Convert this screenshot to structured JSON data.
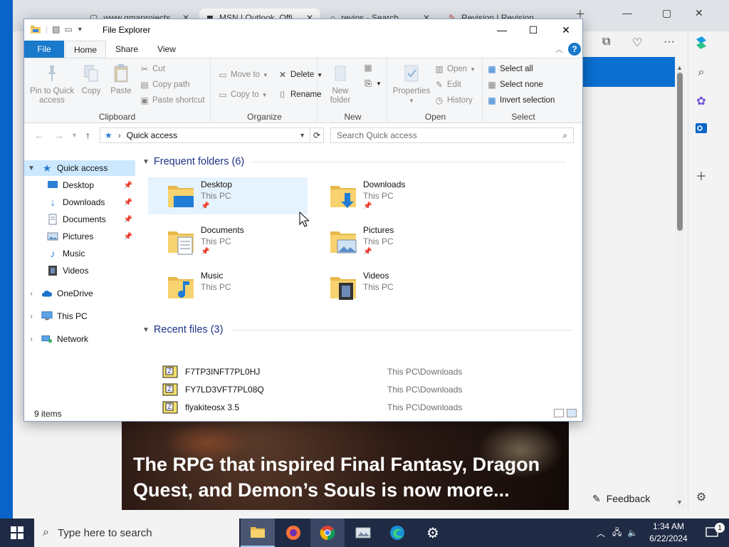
{
  "browser": {
    "tabs": [
      {
        "label": "www.gmaprojects",
        "close": "✕"
      },
      {
        "label": "MSN | Outlook, Offi",
        "close": "✕"
      },
      {
        "label": "revios - Search",
        "close": "✕"
      },
      {
        "label": "Revision | Revision",
        "close": "✕"
      }
    ],
    "news_headline": "The RPG that inspired Final Fantasy, Dragon Quest, and Demon’s Souls is now more...",
    "feedback_label": "Feedback"
  },
  "explorer": {
    "title": "File Explorer",
    "tabs": {
      "file": "File",
      "home": "Home",
      "share": "Share",
      "view": "View"
    },
    "ribbon": {
      "clipboard": {
        "group": "Clipboard",
        "pin_to_quick_access": "Pin to Quick access",
        "copy": "Copy",
        "paste": "Paste",
        "cut": "Cut",
        "copy_path": "Copy path",
        "paste_shortcut": "Paste shortcut"
      },
      "organize": {
        "group": "Organize",
        "move_to": "Move to",
        "copy_to": "Copy to",
        "delete": "Delete",
        "rename": "Rename"
      },
      "new": {
        "group": "New",
        "new_folder": "New folder"
      },
      "open": {
        "group": "Open",
        "properties": "Properties",
        "open": "Open",
        "edit": "Edit",
        "history": "History"
      },
      "select": {
        "group": "Select",
        "select_all": "Select all",
        "select_none": "Select none",
        "invert_selection": "Invert selection"
      }
    },
    "address": {
      "path": "Quick access",
      "search_placeholder": "Search Quick access"
    },
    "nav": [
      {
        "label": "Quick access",
        "level": 0,
        "selected": true
      },
      {
        "label": "Desktop",
        "level": 1,
        "pinned": true
      },
      {
        "label": "Downloads",
        "level": 1,
        "pinned": true
      },
      {
        "label": "Documents",
        "level": 1,
        "pinned": true
      },
      {
        "label": "Pictures",
        "level": 1,
        "pinned": true
      },
      {
        "label": "Music",
        "level": 1
      },
      {
        "label": "Videos",
        "level": 1
      },
      {
        "label": "OneDrive",
        "level": 0
      },
      {
        "label": "This PC",
        "level": 0
      },
      {
        "label": "Network",
        "level": 0
      }
    ],
    "frequent_header": "Frequent folders (6)",
    "frequent": [
      {
        "name": "Desktop",
        "location": "This PC",
        "pinned": true
      },
      {
        "name": "Downloads",
        "location": "This PC",
        "pinned": true
      },
      {
        "name": "Documents",
        "location": "This PC",
        "pinned": true
      },
      {
        "name": "Pictures",
        "location": "This PC",
        "pinned": true
      },
      {
        "name": "Music",
        "location": "This PC",
        "pinned": false
      },
      {
        "name": "Videos",
        "location": "This PC",
        "pinned": false
      }
    ],
    "recent_header": "Recent files (3)",
    "recent": [
      {
        "name": "F7TP3INFT7PL0HJ",
        "path": "This PC\\Downloads"
      },
      {
        "name": "FY7LD3VFT7PL08Q",
        "path": "This PC\\Downloads"
      },
      {
        "name": "flyakiteosx 3.5",
        "path": "This PC\\Downloads"
      }
    ],
    "status": "9 items"
  },
  "taskbar": {
    "search_placeholder": "Type here to search",
    "time": "1:34 AM",
    "date": "6/22/2024",
    "notification_count": "1"
  },
  "colors": {
    "accent": "#1979ca",
    "selection": "#cce8ff",
    "group_header": "#1e3287",
    "taskbar": "#1f2a44"
  }
}
